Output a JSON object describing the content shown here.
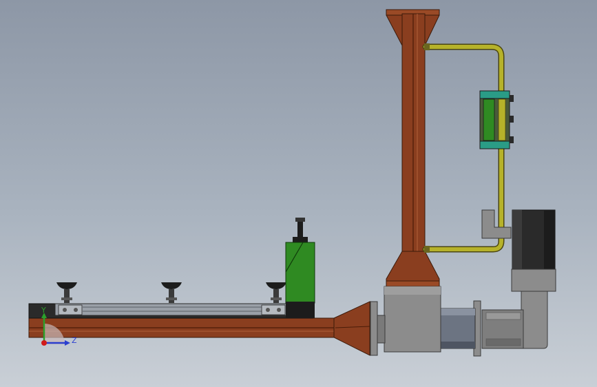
{
  "triad": {
    "y_label": "Y",
    "z_label": "Z"
  },
  "colors": {
    "background_top": "#8d97a6",
    "background_bottom": "#c9cfd6",
    "rust_frame": "#8a3e1f",
    "rust_frame_dark": "#5a2410",
    "pipe_yellow": "#b6b22a",
    "motor_green": "#2f8a22",
    "valve_teal": "#2a9c86",
    "gray_housing": "#8c8c8c",
    "dark_part": "#2a2a2a",
    "axis_y": "#2ba02b",
    "axis_z": "#2b3fcf",
    "origin": "#d11a1a"
  }
}
